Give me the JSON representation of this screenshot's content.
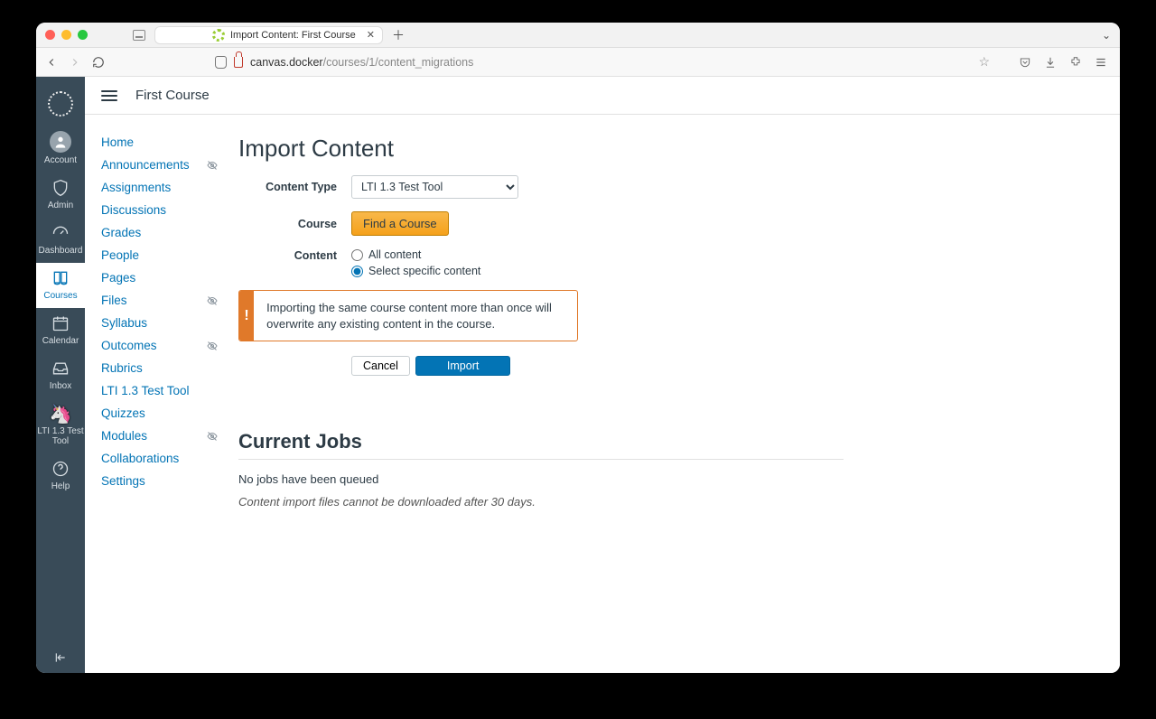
{
  "browser": {
    "tab_title": "Import Content: First Course",
    "url_host": "canvas.docker",
    "url_path": "/courses/1/content_migrations"
  },
  "global_nav": {
    "items": [
      {
        "label": "Account"
      },
      {
        "label": "Admin"
      },
      {
        "label": "Dashboard"
      },
      {
        "label": "Courses"
      },
      {
        "label": "Calendar"
      },
      {
        "label": "Inbox"
      },
      {
        "label": "LTI 1.3 Test Tool"
      },
      {
        "label": "Help"
      }
    ]
  },
  "breadcrumb": {
    "course": "First Course"
  },
  "course_nav": {
    "items": [
      {
        "label": "Home",
        "hidden": false
      },
      {
        "label": "Announcements",
        "hidden": true
      },
      {
        "label": "Assignments",
        "hidden": false
      },
      {
        "label": "Discussions",
        "hidden": false
      },
      {
        "label": "Grades",
        "hidden": false
      },
      {
        "label": "People",
        "hidden": false
      },
      {
        "label": "Pages",
        "hidden": false
      },
      {
        "label": "Files",
        "hidden": true
      },
      {
        "label": "Syllabus",
        "hidden": false
      },
      {
        "label": "Outcomes",
        "hidden": true
      },
      {
        "label": "Rubrics",
        "hidden": false
      },
      {
        "label": "LTI 1.3 Test Tool",
        "hidden": false
      },
      {
        "label": "Quizzes",
        "hidden": false
      },
      {
        "label": "Modules",
        "hidden": true
      },
      {
        "label": "Collaborations",
        "hidden": false
      },
      {
        "label": "Settings",
        "hidden": false
      }
    ]
  },
  "import": {
    "heading": "Import Content",
    "labels": {
      "content_type": "Content Type",
      "course": "Course",
      "content": "Content"
    },
    "content_type_value": "LTI 1.3 Test Tool",
    "find_course_btn": "Find a Course",
    "radio_all": "All content",
    "radio_specific": "Select specific content",
    "selected_radio": "specific",
    "alert": "Importing the same course content more than once will overwrite any existing content in the course.",
    "cancel_btn": "Cancel",
    "import_btn": "Import"
  },
  "jobs": {
    "heading": "Current Jobs",
    "empty": "No jobs have been queued",
    "retention_note": "Content import files cannot be downloaded after 30 days."
  }
}
